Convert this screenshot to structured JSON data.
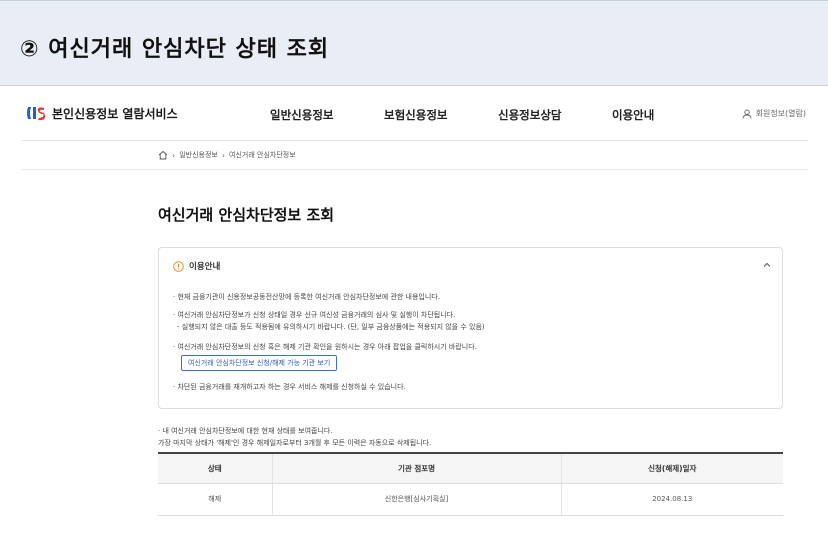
{
  "banner": {
    "title": "② 여신거래 안심차단 상태 조회"
  },
  "site": {
    "logo_text": "본인신용정보 열람서비스",
    "nav": [
      "일반신용정보",
      "보험신용정보",
      "신용정보상담",
      "이용안내"
    ],
    "user_link": "회원정보(열람)"
  },
  "breadcrumb": {
    "items": [
      "일반신용정보",
      "여신거래 안심차단정보"
    ]
  },
  "page": {
    "title": "여신거래 안심차단정보 조회"
  },
  "info": {
    "heading": "이용안내",
    "lines": [
      "· 현재 금융기관이 신용정보공동전산망에 등록한 여신거래 안심차단정보에 관한 내용입니다.",
      "· 여신거래 안심차단정보가 신청 상태일 경우 신규 여신성 금융거래의 심사 및 실행이 차단됩니다.",
      "  - 실행되지 않은 대출 등도 적용됨에 유의하시기 바랍니다. (단, 일부 금융상품에는 적용되지 않을 수 있음)",
      "· 여신거래 안심차단정보의 신청 혹은 해제 기관 확인을 원하시는 경우 아래 팝업을 클릭하시기 바랍니다.",
      "· 차단된 금융거래를 재개하고자 하는 경우 서비스 해제를 신청하실 수 있습니다."
    ],
    "button_label": "여신거래 안심차단정보 신청/해제 가능 기관 보기"
  },
  "notice": {
    "line1": "· 내 여신거래 안심차단정보에 대한 현재 상태를 보여줍니다.",
    "line2": "가장 마지막 상태가 '해제'인 경우 해제일자로부터 3개월 후 모든 이력은 자동으로 삭제됩니다."
  },
  "table": {
    "headers": [
      "상태",
      "기관 점포명",
      "신청(해제)일자"
    ],
    "rows": [
      [
        "해제",
        "신한은행[심사기획실]",
        "2024.08.13"
      ]
    ]
  }
}
